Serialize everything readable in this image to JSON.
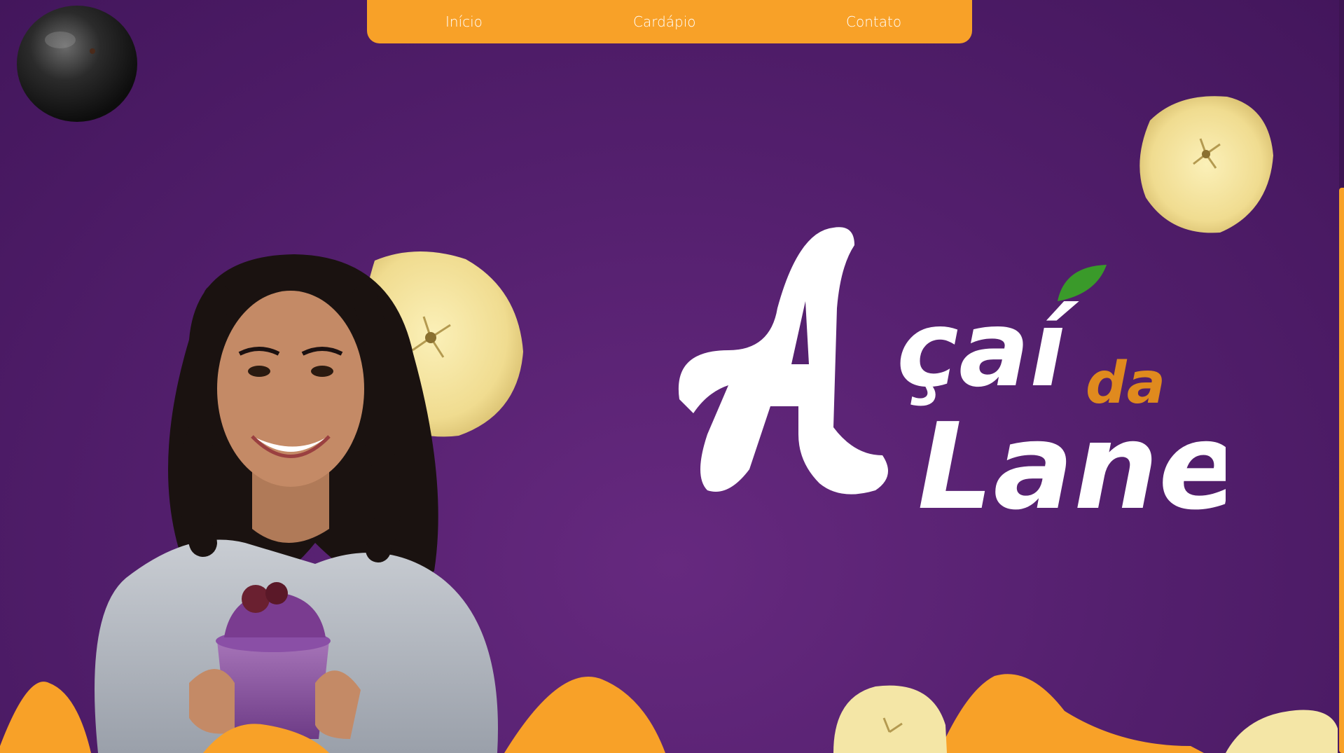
{
  "nav": {
    "items": [
      {
        "label": "Início"
      },
      {
        "label": "Cardápio"
      },
      {
        "label": "Contato"
      }
    ]
  },
  "hero": {
    "logo_text": "Açaí da Lane",
    "image": "woman-holding-acai-cup"
  },
  "decor": {
    "fruits": [
      "acai-berry",
      "banana-slice",
      "banana-slice",
      "banana-slice",
      "banana-slice"
    ]
  },
  "colors": {
    "background": "#55206f",
    "accent": "#f8a128",
    "logo_primary": "#ffffff",
    "logo_secondary": "#e08a1e",
    "leaf": "#3a9a2a"
  }
}
